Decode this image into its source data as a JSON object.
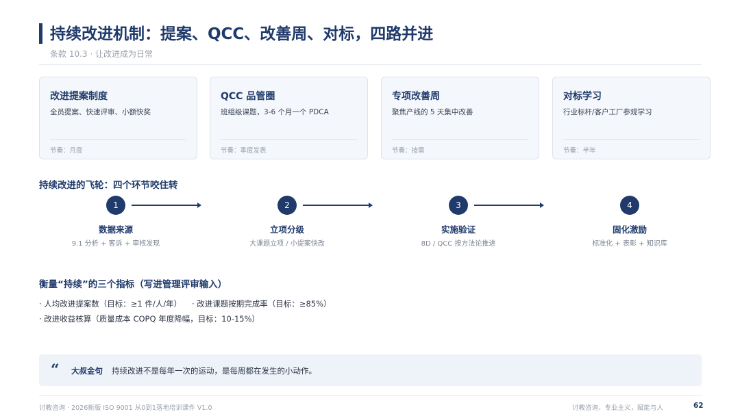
{
  "header": {
    "title": "持续改进机制：提案、QCC、改善周、对标，四路并进",
    "subtitle": "条款 10.3 · 让改进成为日常"
  },
  "cards": [
    {
      "title": "改进提案制度",
      "desc": "全员提案、快速评审、小额快奖",
      "rhythm": "节奏：月度"
    },
    {
      "title": "QCC 品管圈",
      "desc": "班组级课题，3-6 个月一个 PDCA",
      "rhythm": "节奏：季度发表"
    },
    {
      "title": "专项改善周",
      "desc": "聚焦产线的 5 天集中改善",
      "rhythm": "节奏：按需"
    },
    {
      "title": "对标学习",
      "desc": "行业标杆/客户工厂参观学习",
      "rhythm": "节奏：半年"
    }
  ],
  "flywheel": {
    "heading": "持续改进的飞轮：四个环节咬住转",
    "steps": [
      {
        "num": "1",
        "name": "数据来源",
        "desc": "9.1 分析 + 客诉 + 审核发现"
      },
      {
        "num": "2",
        "name": "立项分级",
        "desc": "大课题立项 / 小提案快改"
      },
      {
        "num": "3",
        "name": "实施验证",
        "desc": "8D / QCC 按方法论推进"
      },
      {
        "num": "4",
        "name": "固化激励",
        "desc": "标准化 + 表彰 + 知识库"
      }
    ]
  },
  "metrics": {
    "heading": "衡量“持续”的三个指标（写进管理评审输入）",
    "items": [
      "· 人均改进提案数（目标：≥1 件/人/年）",
      "· 改进课题按期完成率（目标：≥85%）",
      "· 改进收益核算（质量成本 COPQ 年度降幅，目标：10-15%）"
    ]
  },
  "quote": {
    "icon": "quote-mark-icon",
    "label": "大叔金句",
    "text": "持续改进不是每年一次的运动，是每周都在发生的小动作。"
  },
  "footer": {
    "left": "讨教咨询 · 2026新版 ISO 9001 从0到1落地培训课件 V1.0",
    "right": "讨教咨询，专业主义，赋能与人",
    "page": "62"
  },
  "colors": {
    "accent": "#1f3a6b",
    "card_bg": "#f4f7fb",
    "quote_bg": "#eef3f9",
    "muted": "#9aa1ab"
  }
}
